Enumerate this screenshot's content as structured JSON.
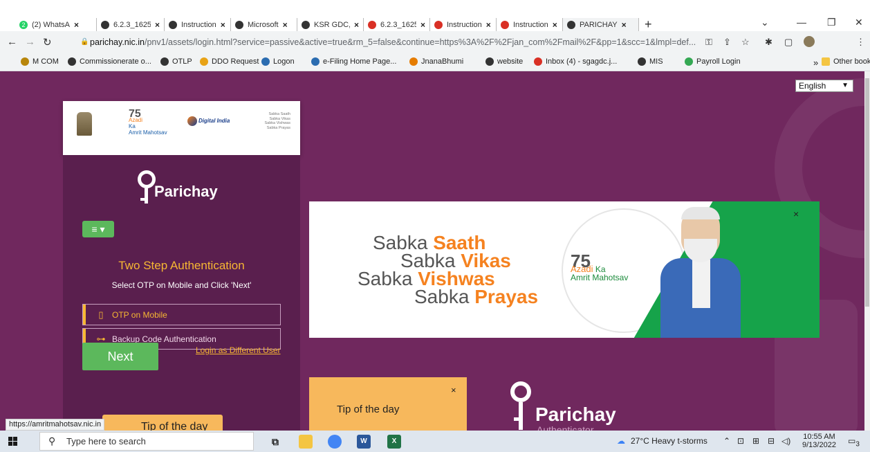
{
  "browser": {
    "tabs": [
      {
        "label": "(2) WhatsA",
        "icon": "whatsapp-icon",
        "color": "#25D366",
        "badge": "2"
      },
      {
        "label": "6.2.3_1625",
        "icon": "globe-icon",
        "color": "#333333"
      },
      {
        "label": "Instruction",
        "icon": "globe-icon",
        "color": "#333333"
      },
      {
        "label": "Microsoft",
        "icon": "globe-icon",
        "color": "#333333"
      },
      {
        "label": "KSR GDC,",
        "icon": "globe-icon",
        "color": "#333333"
      },
      {
        "label": "6.2.3_1625",
        "icon": "red-flower-icon",
        "color": "#d93025"
      },
      {
        "label": "Instruction",
        "icon": "red-flower-icon",
        "color": "#d93025"
      },
      {
        "label": "Instruction",
        "icon": "red-flower-icon",
        "color": "#d93025"
      },
      {
        "label": "PARICHAY",
        "icon": "key-icon",
        "color": "#333333",
        "active": true
      }
    ],
    "url_host": "parichay.nic.in",
    "url_rest": "/pnv1/assets/login.html?service=passive&active=true&rm_5=false&continue=https%3A%2F%2Fjan_com%2Fmail%2F&pp=1&scc=1&lmpl=def...",
    "bookmarks": [
      {
        "label": "M COM",
        "color": "#b8860b"
      },
      {
        "label": "Commissionerate o...",
        "color": "#333333"
      },
      {
        "label": "OTLP",
        "color": "#333333"
      },
      {
        "label": "DDO Request",
        "color": "#e8a317"
      },
      {
        "label": "Logon",
        "color": "#2b6cb0"
      },
      {
        "label": "e-Filing Home Page...",
        "color": "#2b6cb0"
      },
      {
        "label": "JnanaBhumi",
        "color": "#e57c00"
      },
      {
        "label": "website",
        "color": "#333333"
      },
      {
        "label": "Inbox (4) - sgagdc.j...",
        "color": "#d93025"
      },
      {
        "label": "MIS",
        "color": "#333333"
      },
      {
        "label": "Payroll Login",
        "color": "#34a853"
      }
    ],
    "other_bookmarks": "Other bookmarks",
    "status_url": "https://amritmahotsav.nic.in"
  },
  "page": {
    "language": "English",
    "logos": {
      "akam_number": "75",
      "akam_line1": "Azadi",
      "akam_line2": "Ka",
      "akam_line3": "Amrit Mahotsav",
      "digital_india": "Digital India",
      "saath_lines": [
        "Sabka Saath",
        "Sabka Vikas",
        "Sabka Vishwas",
        "Sabka Prayas"
      ]
    },
    "brand": "Parichay",
    "title": "Two Step Authentication",
    "subtitle": "Select OTP on Mobile and Click 'Next'",
    "options": [
      {
        "label": "OTP on Mobile",
        "icon": "mobile-icon"
      },
      {
        "label": "Backup Code Authentication",
        "icon": "key-icon"
      }
    ],
    "next_label": "Next",
    "different_user": "Login as Different User",
    "tip_left": "Tip of the day",
    "banner": {
      "sabka": "Sabka",
      "words": [
        "Saath",
        "Vikas",
        "Vishwas",
        "Prayas"
      ],
      "akam_number": "75",
      "akam_azadi": "Azadi",
      "akam_ka": "Ka",
      "akam_amrit": "Amrit Mahotsav",
      "close": "×"
    },
    "tip": {
      "title": "Tip of the day",
      "close": "×"
    },
    "authenticator": {
      "name": "Parichay",
      "sub": "Authenticator"
    }
  },
  "taskbar": {
    "search_placeholder": "Type here to search",
    "weather": "27°C  Heavy t-storms",
    "time": "10:55 AM",
    "date": "9/13/2022",
    "notification_count": "3"
  },
  "colors": {
    "page_bg": "#70285e",
    "panel_bg": "#5a1f4e",
    "accent_orange": "#f7b733",
    "button_green": "#5cb85c"
  }
}
